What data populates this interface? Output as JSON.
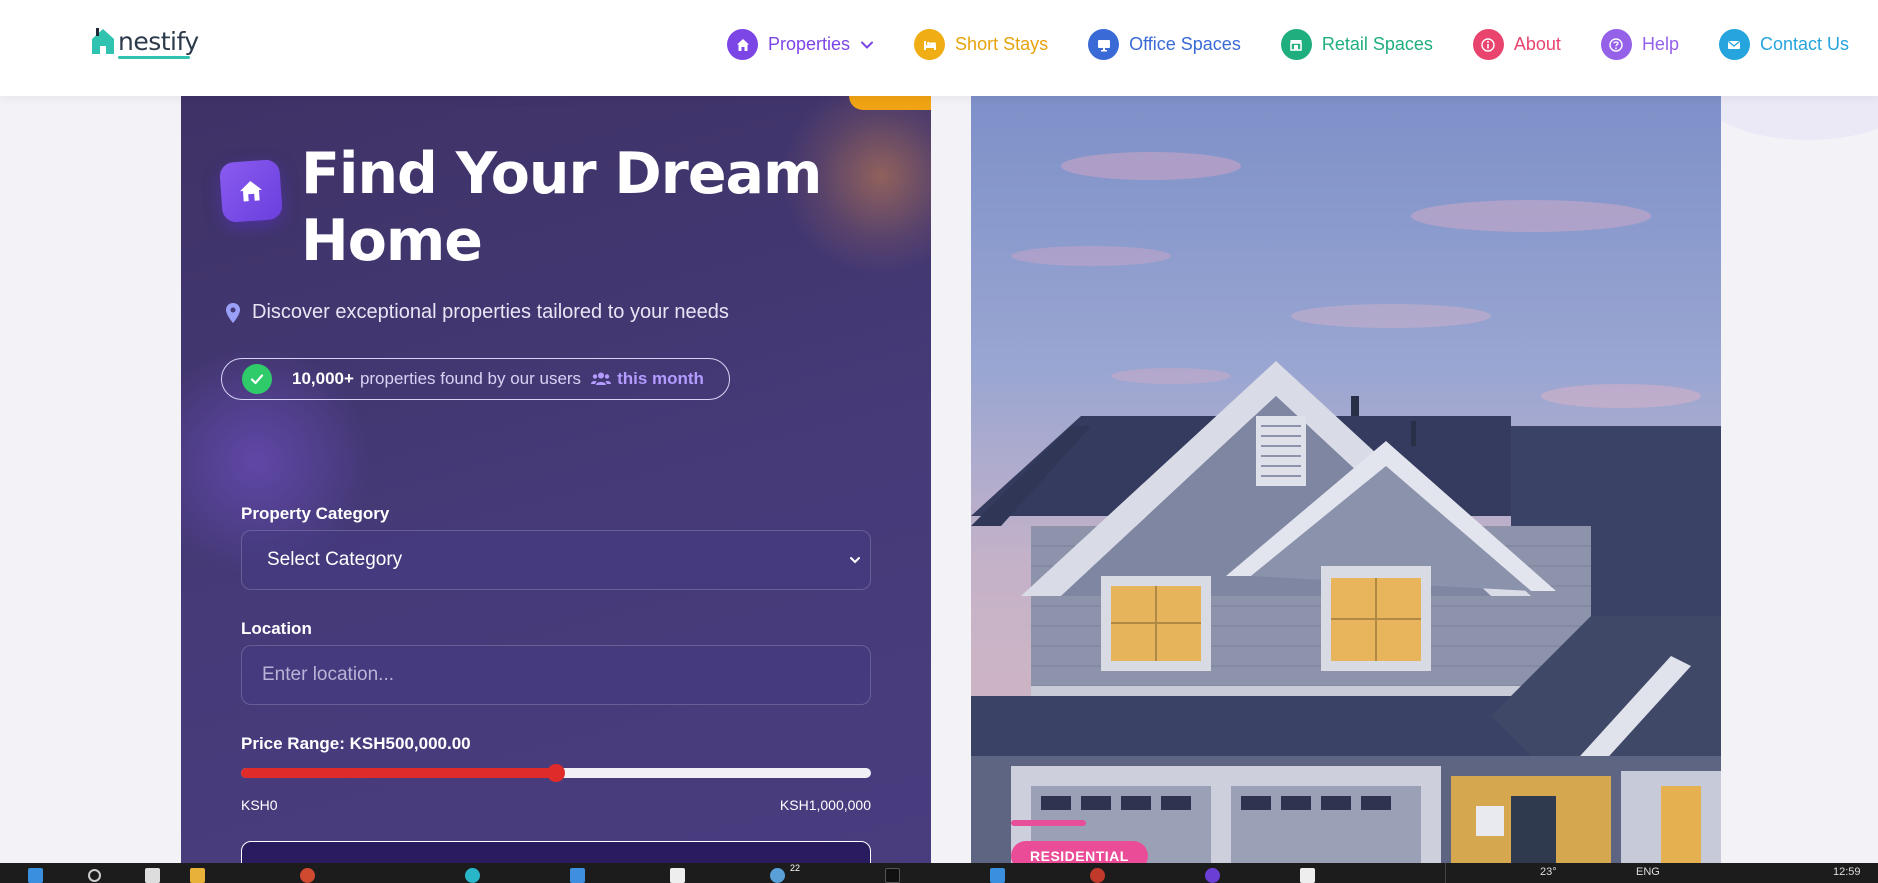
{
  "brand": {
    "name": "nestify"
  },
  "nav": [
    {
      "label": "Properties",
      "icon": "home-icon",
      "color": "#7c45e6",
      "dropdown": true
    },
    {
      "label": "Short Stays",
      "icon": "bed-icon",
      "color": "#e8a30c"
    },
    {
      "label": "Office Spaces",
      "icon": "monitor-icon",
      "color": "#3a6ad6"
    },
    {
      "label": "Retail Spaces",
      "icon": "store-icon",
      "color": "#1fae7e"
    },
    {
      "label": "About",
      "icon": "info-icon",
      "color": "#e8446e"
    },
    {
      "label": "Help",
      "icon": "question-icon",
      "color": "#9461e8"
    },
    {
      "label": "Contact Us",
      "icon": "mail-icon",
      "color": "#25a4dd"
    }
  ],
  "hero": {
    "title_line1": "Find Your Dream",
    "title_line2": "Home",
    "subtitle": "Discover exceptional properties tailored to your needs",
    "stat_count": "10,000+",
    "stat_text": "properties found by our users",
    "stat_period": "this month"
  },
  "form": {
    "category_label": "Property Category",
    "category_value": "Select Category",
    "location_label": "Location",
    "location_placeholder": "Enter location...",
    "price_label": "Price Range: KSH500,000.00",
    "price_min": "KSH0",
    "price_max": "KSH1,000,000",
    "price_fraction": 0.5
  },
  "image": {
    "badge": "RESIDENTIAL"
  },
  "taskbar": {
    "weather": "23°",
    "lang": "ENG",
    "clock": "12:59",
    "notif_count": "22"
  }
}
